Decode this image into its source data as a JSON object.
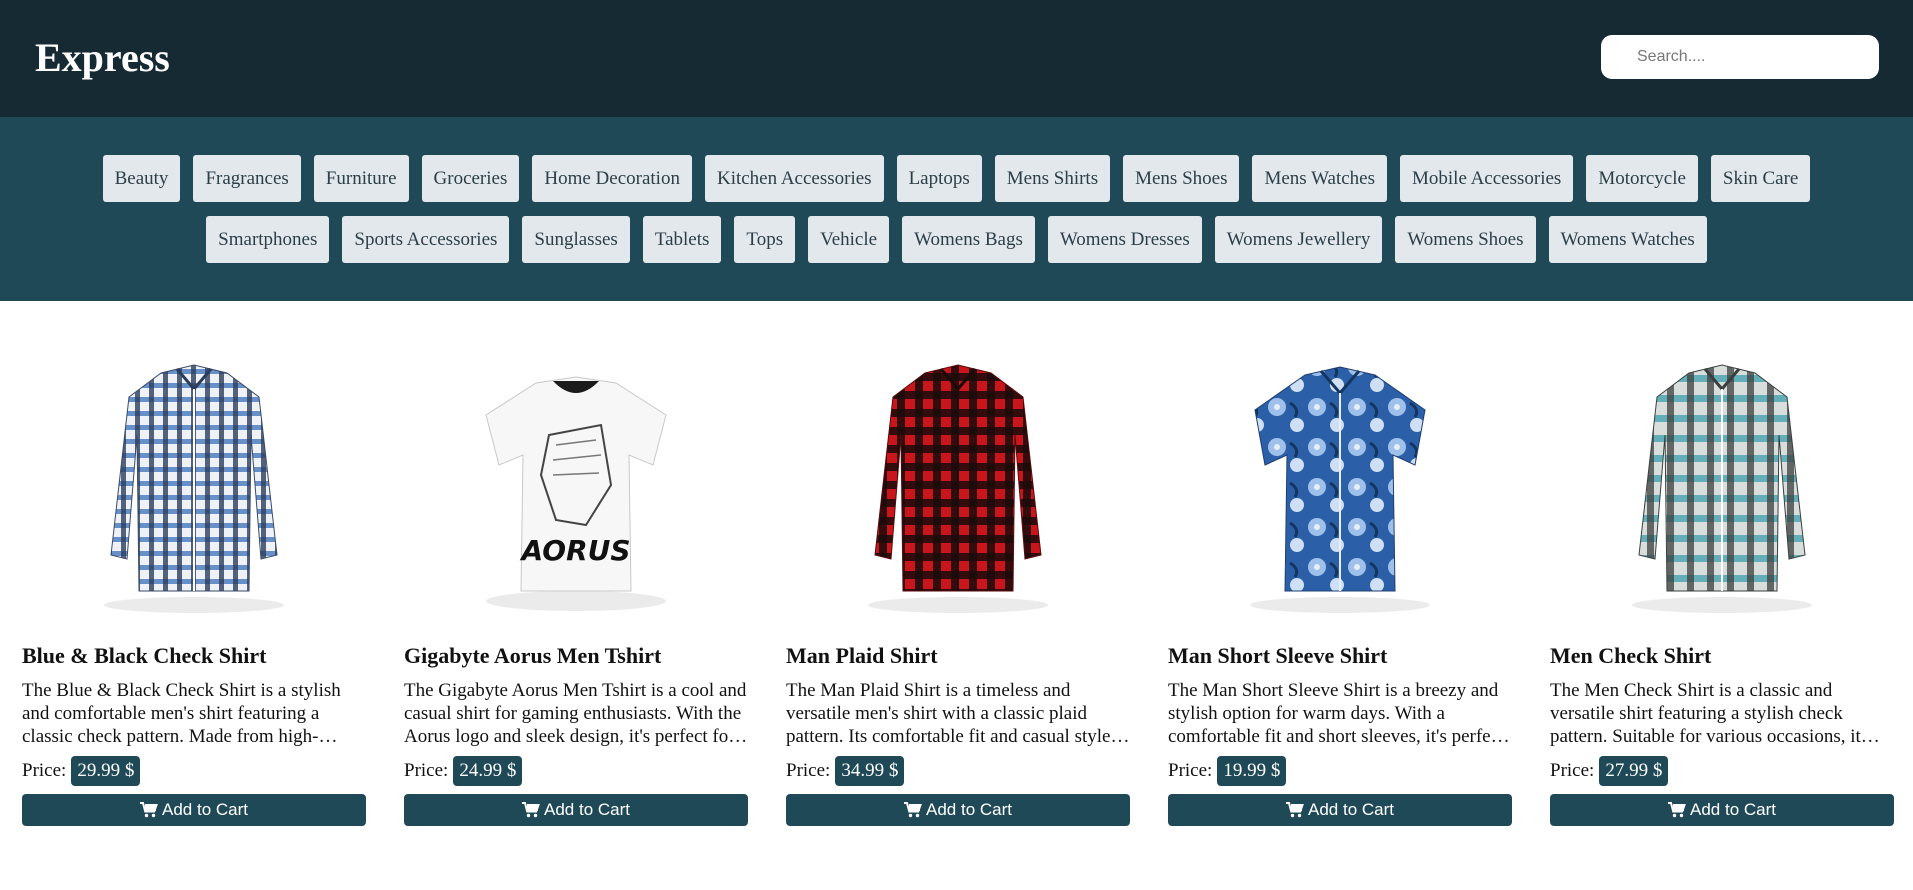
{
  "header": {
    "logo": "Express",
    "search_placeholder": "Search...."
  },
  "categories": [
    "Beauty",
    "Fragrances",
    "Furniture",
    "Groceries",
    "Home Decoration",
    "Kitchen Accessories",
    "Laptops",
    "Mens Shirts",
    "Mens Shoes",
    "Mens Watches",
    "Mobile Accessories",
    "Motorcycle",
    "Skin Care",
    "Smartphones",
    "Sports Accessories",
    "Sunglasses",
    "Tablets",
    "Tops",
    "Vehicle",
    "Womens Bags",
    "Womens Dresses",
    "Womens Jewellery",
    "Womens Shoes",
    "Womens Watches"
  ],
  "price_label": "Price:",
  "cart_label": "Add to Cart",
  "products": [
    {
      "title": "Blue & Black Check Shirt",
      "description": "The Blue & Black Check Shirt is a stylish and comfortable men's shirt featuring a classic check pattern. Made from high-quality fabric, it's suitable for both casual and semi-formal occasions.",
      "price": "29.99 $"
    },
    {
      "title": "Gigabyte Aorus Men Tshirt",
      "description": "The Gigabyte Aorus Men Tshirt is a cool and casual shirt for gaming enthusiasts. With the Aorus logo and sleek design, it's perfect for expressing your gaming style.",
      "price": "24.99 $"
    },
    {
      "title": "Man Plaid Shirt",
      "description": "The Man Plaid Shirt is a timeless and versatile men's shirt with a classic plaid pattern. Its comfortable fit and casual style make it a wardrobe essential.",
      "price": "34.99 $"
    },
    {
      "title": "Man Short Sleeve Shirt",
      "description": "The Man Short Sleeve Shirt is a breezy and stylish option for warm days. With a comfortable fit and short sleeves, it's perfect for a laid-back look.",
      "price": "19.99 $"
    },
    {
      "title": "Men Check Shirt",
      "description": "The Men Check Shirt is a classic and versatile shirt featuring a stylish check pattern. Suitable for various occasions, it adds a smart touch to your attire.",
      "price": "27.99 $"
    }
  ],
  "image_icons": [
    "blue-check-shirt-image",
    "white-aorus-tshirt-image",
    "red-plaid-shirt-image",
    "blue-floral-shirt-image",
    "teal-check-shirt-image"
  ],
  "colors": {
    "header_bg": "#152a33",
    "category_bar_bg": "#204958",
    "accent": "#204958",
    "category_button_bg": "#e2e8ec"
  }
}
